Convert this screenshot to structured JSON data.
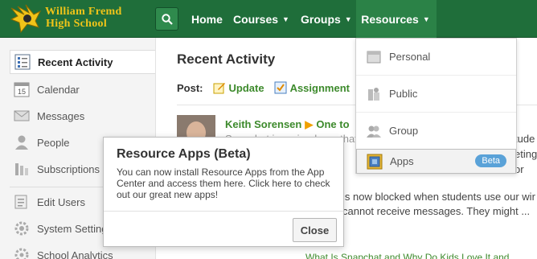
{
  "header": {
    "school_line1": "William Fremd",
    "school_line2": "High School",
    "nav": {
      "home": "Home",
      "courses": "Courses",
      "groups": "Groups",
      "resources": "Resources"
    },
    "colors": {
      "bar": "#1f6e3a",
      "active_tab": "#2b8247",
      "school_text": "#f0c419"
    }
  },
  "sidebar": {
    "items": [
      {
        "label": "Recent Activity",
        "icon": "recent-activity-icon",
        "active": true
      },
      {
        "label": "Calendar",
        "icon": "calendar-icon"
      },
      {
        "label": "Messages",
        "icon": "envelope-icon"
      },
      {
        "label": "People",
        "icon": "person-icon"
      },
      {
        "label": "Subscriptions",
        "icon": "subscriptions-icon"
      },
      {
        "label": "Edit Users",
        "icon": "edit-users-icon"
      },
      {
        "label": "System Setting",
        "icon": "gear-icon"
      },
      {
        "label": "School Analytics",
        "icon": "analytics-icon"
      }
    ],
    "calendar_day": "15"
  },
  "main": {
    "title": "Recent Activity",
    "post_label": "Post:",
    "post_update": "Update",
    "post_assignment": "Assignment",
    "author": "Keith Sorensen",
    "target": "One to",
    "line1": "Snapchat is an ipad app that",
    "line1_right": "tude",
    "line2_right": "eting",
    "line3_right": "or",
    "line4": "is now blocked when students use our wir",
    "line5": "cannot receive messages. They might ...",
    "bottom_link": "What Is Snapchat and Why Do Kids Love It and"
  },
  "dropdown": {
    "items": [
      {
        "label": "Personal",
        "icon": "personal-resources-icon"
      },
      {
        "label": "Public",
        "icon": "public-resources-icon"
      },
      {
        "label": "Group",
        "icon": "group-resources-icon"
      },
      {
        "label": "Apps",
        "icon": "apps-icon",
        "badge": "Beta",
        "active": true
      }
    ]
  },
  "popup": {
    "title": "Resource Apps (Beta)",
    "body": "You can now install Resource Apps from the App Center and access them here. Click here to check out our great new apps!",
    "close": "Close"
  }
}
